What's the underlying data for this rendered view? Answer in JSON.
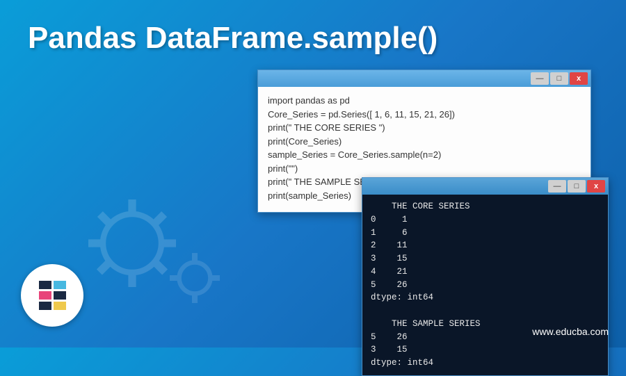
{
  "title": "Pandas DataFrame.sample()",
  "code_window": {
    "lines": [
      "import pandas as pd",
      "Core_Series = pd.Series([ 1, 6, 11, 15, 21, 26])",
      "print(\"   THE CORE SERIES \")",
      "print(Core_Series)",
      "sample_Series = Core_Series.sample(n=2)",
      "print(\"\")",
      "print(\"   THE SAMPLE SERIES \")",
      "print(sample_Series)"
    ]
  },
  "terminal_window": {
    "output": "    THE CORE SERIES\n0     1\n1     6\n2    11\n3    15\n4    21\n5    26\ndtype: int64\n\n    THE SAMPLE SERIES\n5    26\n3    15\ndtype: int64"
  },
  "window_controls": {
    "minimize": "—",
    "maximize": "□",
    "close": "x"
  },
  "website": "www.educba.com",
  "colors": {
    "bg_start": "#0a9dd8",
    "bg_end": "#0d5fa8",
    "terminal_bg": "#0a1628",
    "close_btn": "#e04545"
  },
  "chart_data": {
    "type": "table",
    "title": "THE CORE SERIES",
    "series": [
      {
        "name": "Core_Series",
        "index": [
          0,
          1,
          2,
          3,
          4,
          5
        ],
        "values": [
          1,
          6,
          11,
          15,
          21,
          26
        ],
        "dtype": "int64"
      },
      {
        "name": "sample_Series",
        "index": [
          5,
          3
        ],
        "values": [
          26,
          15
        ],
        "dtype": "int64",
        "sample_n": 2
      }
    ]
  }
}
